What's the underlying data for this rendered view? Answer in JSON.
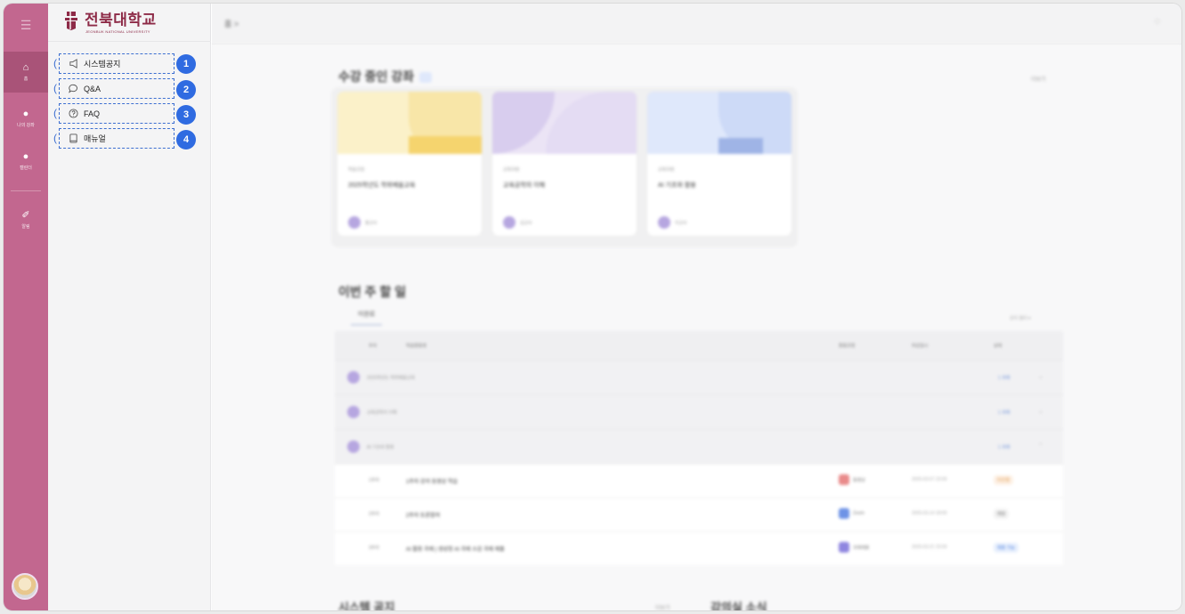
{
  "rail": {
    "menu_icon": "menu-icon",
    "items": [
      {
        "icon": "home-icon",
        "label": "홈"
      },
      {
        "icon": "course-icon",
        "label": "나의 강좌"
      },
      {
        "icon": "calendar-icon",
        "label": "캘린더"
      },
      {
        "icon": "bell-icon",
        "label": "알림"
      }
    ],
    "accent": "#c2678f"
  },
  "logo": {
    "title": "전북대학교",
    "subtitle": "JEONBUK NATIONAL UNIVERSITY",
    "color": "#8d2a47"
  },
  "panel": {
    "items": [
      {
        "label": "시스템공지",
        "icon": "megaphone-icon",
        "badge": "1"
      },
      {
        "label": "Q&A",
        "icon": "chat-icon",
        "badge": "2"
      },
      {
        "label": "FAQ",
        "icon": "help-circle-icon",
        "badge": "3"
      },
      {
        "label": "매뉴얼",
        "icon": "book-icon",
        "badge": "4"
      }
    ],
    "highlight_color": "#3d6fd1",
    "badge_color": "#2f6be1"
  },
  "topbar": {
    "breadcrumb": "홈 >"
  },
  "courses": {
    "title": "수강 중인 강좌",
    "more": "더보기",
    "cards": [
      {
        "category": "학습코칭",
        "name": "2025학년도 학위배움교육",
        "professor": "홍교수",
        "cover": "#fbf1c9",
        "accent": "#f5d884"
      },
      {
        "category": "교육과정",
        "name": "교육공학의 이해",
        "professor": "김교수",
        "cover": "#ebe4f5",
        "accent": "#d4c7ec"
      },
      {
        "category": "교육과정",
        "name": "AI 기초와 활용",
        "professor": "이교수",
        "cover": "#dfe8fb",
        "accent": "#aabde9"
      }
    ]
  },
  "todo": {
    "title": "이번 주 할 일",
    "tab": "미완료",
    "filter": "강의 필터 ▾",
    "headers": [
      "주차",
      "학습활동명",
      "활동유형",
      "마감일시",
      "상태"
    ],
    "groups": [
      {
        "name": "2025학년도 학위배움교육",
        "status": "1 과제"
      },
      {
        "name": "교육공학의 이해",
        "status": "1 과제"
      },
      {
        "name": "AI 기초와 활용",
        "status": "1 과제"
      }
    ],
    "rows": [
      {
        "week": "1주차",
        "title": "1주차 강의 동영상 학습",
        "type": "동영상",
        "type_color": "#e98a8a",
        "due": "2025-03-07 23:59",
        "status": "미진행",
        "status_bg": "#fdf0e4",
        "status_color": "#e09a4e"
      },
      {
        "week": "2주차",
        "title": "2주차 토론참여",
        "type": "Zoom",
        "type_color": "#6e93e6",
        "due": "2025-03-14 18:00",
        "status": "예정",
        "status_bg": "#f1f1f1",
        "status_color": "#777"
      },
      {
        "week": "3주차",
        "title": "AI 활용 과제 | 생성형 AI 과제 소감 과제 제출",
        "type": "과제제출",
        "type_color": "#8f86e0",
        "due": "2025-03-21 23:59",
        "status": "제출 가능",
        "status_bg": "#e7effd",
        "status_color": "#4d7fdc"
      }
    ]
  },
  "bottom": {
    "notice_title": "시스템 공지",
    "notice_more": "더보기",
    "news_title": "강의실 소식"
  }
}
